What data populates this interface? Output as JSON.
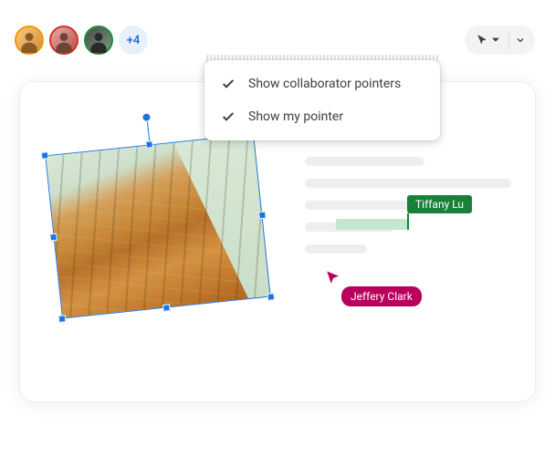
{
  "collaborators": {
    "avatars": [
      {
        "name": "collaborator-1",
        "ring_color": "#f29900"
      },
      {
        "name": "collaborator-2",
        "ring_color": "#d93025"
      },
      {
        "name": "collaborator-3",
        "ring_color": "#1e8e3e"
      }
    ],
    "overflow_label": "+4"
  },
  "pointer_control": {
    "icon": "cursor-icon"
  },
  "dropdown": {
    "items": [
      {
        "checked": true,
        "label": "Show collaborator pointers"
      },
      {
        "checked": true,
        "label": "Show my pointer"
      }
    ]
  },
  "live_cursors": {
    "green": {
      "name": "Tiffany Lu",
      "color": "#188038"
    },
    "pink": {
      "name": "Jeffery Clark",
      "color": "#b8005c"
    }
  },
  "selected_object": {
    "type": "image",
    "description": "building-photo"
  }
}
